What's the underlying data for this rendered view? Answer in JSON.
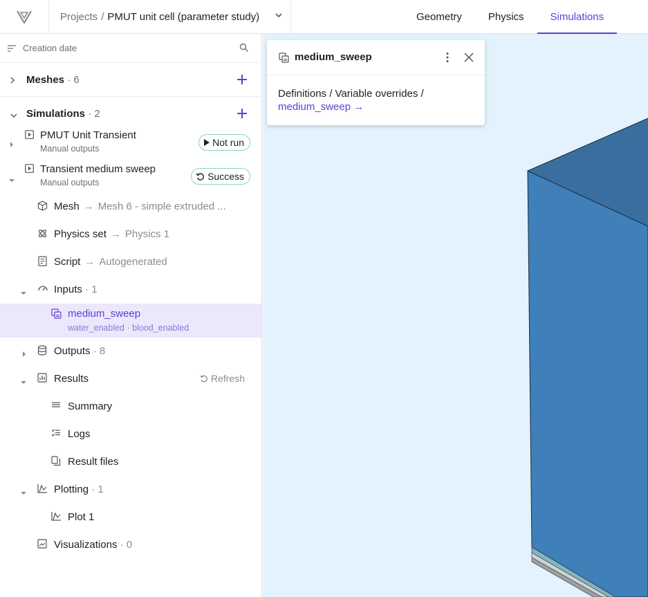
{
  "header": {
    "breadcrumb_root": "Projects",
    "breadcrumb_separator": "/",
    "project_name": "PMUT unit cell (parameter study)",
    "tabs": [
      {
        "label": "Geometry",
        "active": false
      },
      {
        "label": "Physics",
        "active": false
      },
      {
        "label": "Simulations",
        "active": true
      }
    ]
  },
  "sidebar": {
    "sort_label": "Creation date",
    "meshes": {
      "title": "Meshes",
      "count": "· 6"
    },
    "simulations": {
      "title": "Simulations",
      "count": "· 2"
    },
    "sims": [
      {
        "name": "PMUT Unit Transient",
        "sub": "Manual outputs",
        "status": "Not run",
        "status_icon": "play-icon"
      },
      {
        "name": "Transient medium sweep",
        "sub": "Manual outputs",
        "status": "Success",
        "status_icon": "refresh-icon"
      }
    ],
    "tree": {
      "mesh": {
        "label": "Mesh",
        "target": "Mesh 6 - simple extruded ..."
      },
      "physics": {
        "label": "Physics set",
        "target": "Physics 1"
      },
      "script": {
        "label": "Script",
        "target": "Autogenerated"
      },
      "inputs": {
        "label": "Inputs",
        "count": "· 1"
      },
      "selected_input": {
        "label": "medium_sweep",
        "sub": "water_enabled · blood_enabled"
      },
      "outputs": {
        "label": "Outputs",
        "count": "· 8"
      },
      "results": {
        "label": "Results",
        "refresh": "Refresh"
      },
      "summary": {
        "label": "Summary"
      },
      "logs": {
        "label": "Logs"
      },
      "result_files": {
        "label": "Result files"
      },
      "plotting": {
        "label": "Plotting",
        "count": "· 1"
      },
      "plot1": {
        "label": "Plot 1"
      },
      "visualizations": {
        "label": "Visualizations",
        "count": "· 0"
      }
    }
  },
  "popover": {
    "title": "medium_sweep",
    "path": "Definitions / Variable overrides /",
    "link": "medium_sweep →"
  },
  "colors": {
    "accent": "#5b3fd6",
    "viewport_bg": "#e3f2fd",
    "model_face": "#3f7fba",
    "model_top": "#3a6e9e",
    "selected_bg": "#ece7fb",
    "status_border": "#86d7c0"
  }
}
